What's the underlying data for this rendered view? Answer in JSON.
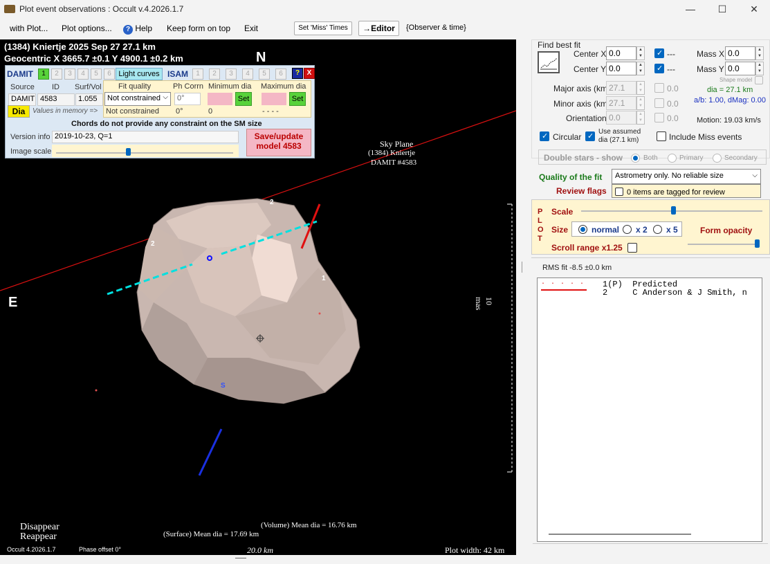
{
  "window": {
    "title": "Plot event observations : Occult v.4.2026.1.7",
    "min": "—",
    "max": "☐",
    "close": "✕"
  },
  "menu": {
    "with_plot": "with Plot...",
    "plot_options": "Plot options...",
    "help": "Help",
    "keep_on_top": "Keep form on top",
    "exit": "Exit",
    "set_miss": "Set 'Miss' Times",
    "editor": "→Editor",
    "observer_time": "{Observer & time}"
  },
  "plot": {
    "line1": "(1384) Kniertje  2025 Sep 27  27.1 km",
    "line2": "Geocentric  X  3665.7 ±0.1  Y 4900.1 ±0.2 km",
    "north": "N",
    "east": "E",
    "sky_plane": "Sky Plane",
    "sky_obj": "(1384) Kniertje",
    "sky_model": "DAMIT #4583",
    "scale_label": "10 mas",
    "chord_labels": [
      "2",
      "2",
      "1"
    ],
    "south": "S",
    "legend_disappear": "Disappear",
    "legend_reappear": "Reappear",
    "vol_mean": "(Volume) Mean dia = 16.76 km",
    "surf_mean": "(Surface) Mean dia = 17.69 km",
    "bar_label": "20.0 km",
    "version": "Occult 4.2026.1.7",
    "phase_offset": "Phase offset 0°",
    "plot_width": "Plot width: 42 km"
  },
  "damit": {
    "damit_label": "DAMIT",
    "nums": [
      "1",
      "2",
      "3",
      "4",
      "5",
      "6"
    ],
    "light_curves": "Light curves",
    "isam_label": "ISAM",
    "isam_nums": [
      "1",
      "2",
      "3",
      "4",
      "5",
      "6"
    ],
    "help": "?",
    "close": "X",
    "source_hdr": "Source",
    "id_hdr": "ID",
    "surf_hdr": "Surf/Vol",
    "source_val": "DAMIT",
    "id_val": "4583",
    "surf_val": "1.055",
    "fit_quality_hdr": "Fit quality",
    "phcorr_hdr": "Ph Corrn",
    "min_dia_hdr": "Minimum dia",
    "max_dia_hdr": "Maximum dia",
    "fit_select": "Not constrained",
    "phcorr_val": "0°",
    "set1": "Set",
    "set2": "Set",
    "dia_btn": "Dia",
    "values_in_memory": "Values in memory =>",
    "mem_fit": "Not constrained",
    "mem_ph": "0°",
    "mem_min": "0",
    "mem_max": "- - - -",
    "chords_note": "Chords do not provide any constraint on the SM size",
    "version_info_lbl": "Version info",
    "version_info": "2019-10-23, Q=1",
    "image_scale_lbl": "Image scale",
    "save_btn": "Save/update model 4583"
  },
  "fit": {
    "find_best_fit": "Find best fit",
    "center_x_lbl": "Center X",
    "center_x": "0.0",
    "center_y_lbl": "Center Y",
    "center_y": "0.0",
    "major_lbl": "Major axis (km)",
    "major": "27.1",
    "minor_lbl": "Minor axis (km)",
    "minor": "27.1",
    "orient_lbl": "Orientation",
    "orient": "0.0",
    "dash1": "---",
    "dash2": "---",
    "zero": "0.0",
    "mass_x_lbl": "Mass X",
    "mass_x": "0.0",
    "mass_y_lbl": "Mass Y",
    "mass_y": "0.0",
    "shape_model": "Shape model",
    "dia": "dia = 27.1 km",
    "ab": "a/b: 1.00, dMag: 0.00",
    "motion": "Motion: 19.03 km/s",
    "circular": "Circular",
    "use_assumed": "Use assumed dia (27.1 km)",
    "include_miss": "Include Miss events",
    "double_stars": "Double stars - show",
    "both": "Both",
    "primary": "Primary",
    "secondary": "Secondary",
    "quality_lbl": "Quality of the fit",
    "quality_val": "Astrometry only. No reliable size",
    "review_lbl": "Review flags",
    "review_val": "0 items are tagged for review"
  },
  "plotctl": {
    "plot_letters": "PLOT",
    "scale_lbl": "Scale",
    "size_lbl": "Size",
    "normal": "normal",
    "x2": "x 2",
    "x5": "x 5",
    "form_opacity": "Form opacity",
    "scroll_range": "Scroll range x1.25"
  },
  "rms": "RMS fit -8.5 ±0.0 km",
  "list": [
    {
      "marker": "· · · · ·",
      "text": "1(P)  Predicted"
    },
    {
      "marker": "———",
      "text": "2     C Anderson & J Smith, n"
    }
  ],
  "colors": {
    "accent": "#0067c0",
    "save_pink": "#f4b7c5",
    "set_green": "#58d23a",
    "quality_green": "#1a7a1a",
    "review_red": "#a01010"
  }
}
